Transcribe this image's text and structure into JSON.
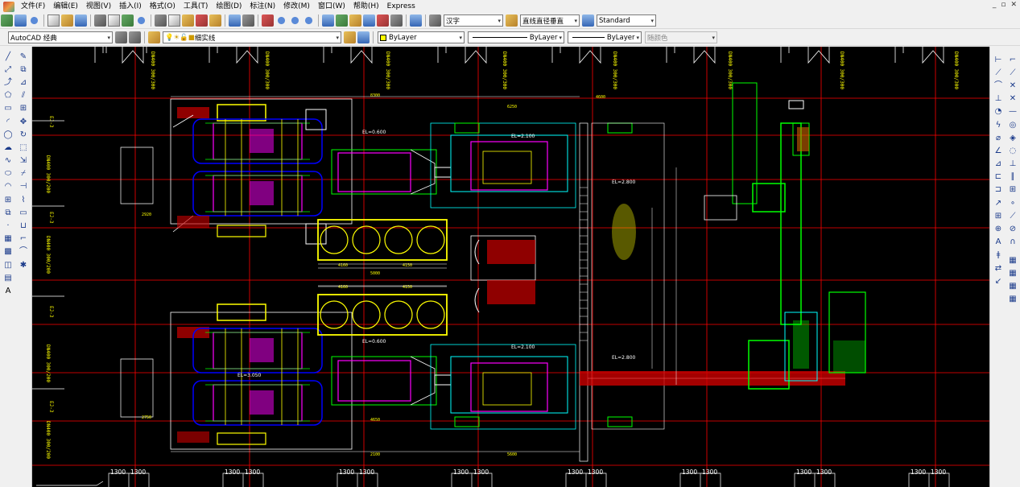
{
  "menubar": {
    "items": [
      "文件(F)",
      "编辑(E)",
      "视图(V)",
      "插入(I)",
      "格式(O)",
      "工具(T)",
      "绘图(D)",
      "标注(N)",
      "修改(M)",
      "窗口(W)",
      "帮助(H)",
      "Express"
    ]
  },
  "toolbar1": {
    "text_style": "汉字",
    "dim_style": "直线直径垂直",
    "table_style": "Standard"
  },
  "toolbar2": {
    "workspace": "AutoCAD 经典",
    "layer": "细实线",
    "color": "ByLayer",
    "linetype": "ByLayer",
    "lineweight": "ByLayer",
    "plot_style": "随颜色"
  },
  "drawing": {
    "bottom_dims": [
      "1300",
      "1300",
      "1300",
      "1300",
      "1300",
      "1300",
      "1300",
      "1300",
      "1300",
      "1300",
      "1300",
      "1300",
      "1300",
      "1300",
      "1300",
      "1300"
    ],
    "el_labels": [
      "EL=0.600",
      "EL=2.100",
      "EL=2.800",
      "EL=0.600",
      "EL=2.100",
      "EL=2.800",
      "EL=3.050"
    ],
    "side_labels": [
      "EJ-3",
      "EJ-3",
      "EJ-3",
      "EJ-3"
    ],
    "col_labels": [
      "DN400 300/300",
      "DN400 300/300",
      "DN400 300/300",
      "DN400 300/300",
      "DN400 300/300",
      "DN400 300/300",
      "DN400 300/300",
      "DN400 300/300"
    ],
    "row_labels": [
      "DN400 300/200",
      "DN400 300/200",
      "DN400 300/200",
      "DN400 300/200"
    ],
    "dims_mid": [
      "4160",
      "4150",
      "5000",
      "4160",
      "4150",
      "4650",
      "2100",
      "5600",
      "8300",
      "6250",
      "4600",
      "2920",
      "2750"
    ]
  },
  "colors": {
    "canvas": "#000000",
    "grid": "#ff0000",
    "accent_yellow": "#ffff00",
    "accent_magenta": "#ff00ff",
    "accent_cyan": "#00ffff",
    "accent_green": "#00ff00",
    "accent_blue": "#0000ff",
    "accent_white": "#ffffff"
  }
}
